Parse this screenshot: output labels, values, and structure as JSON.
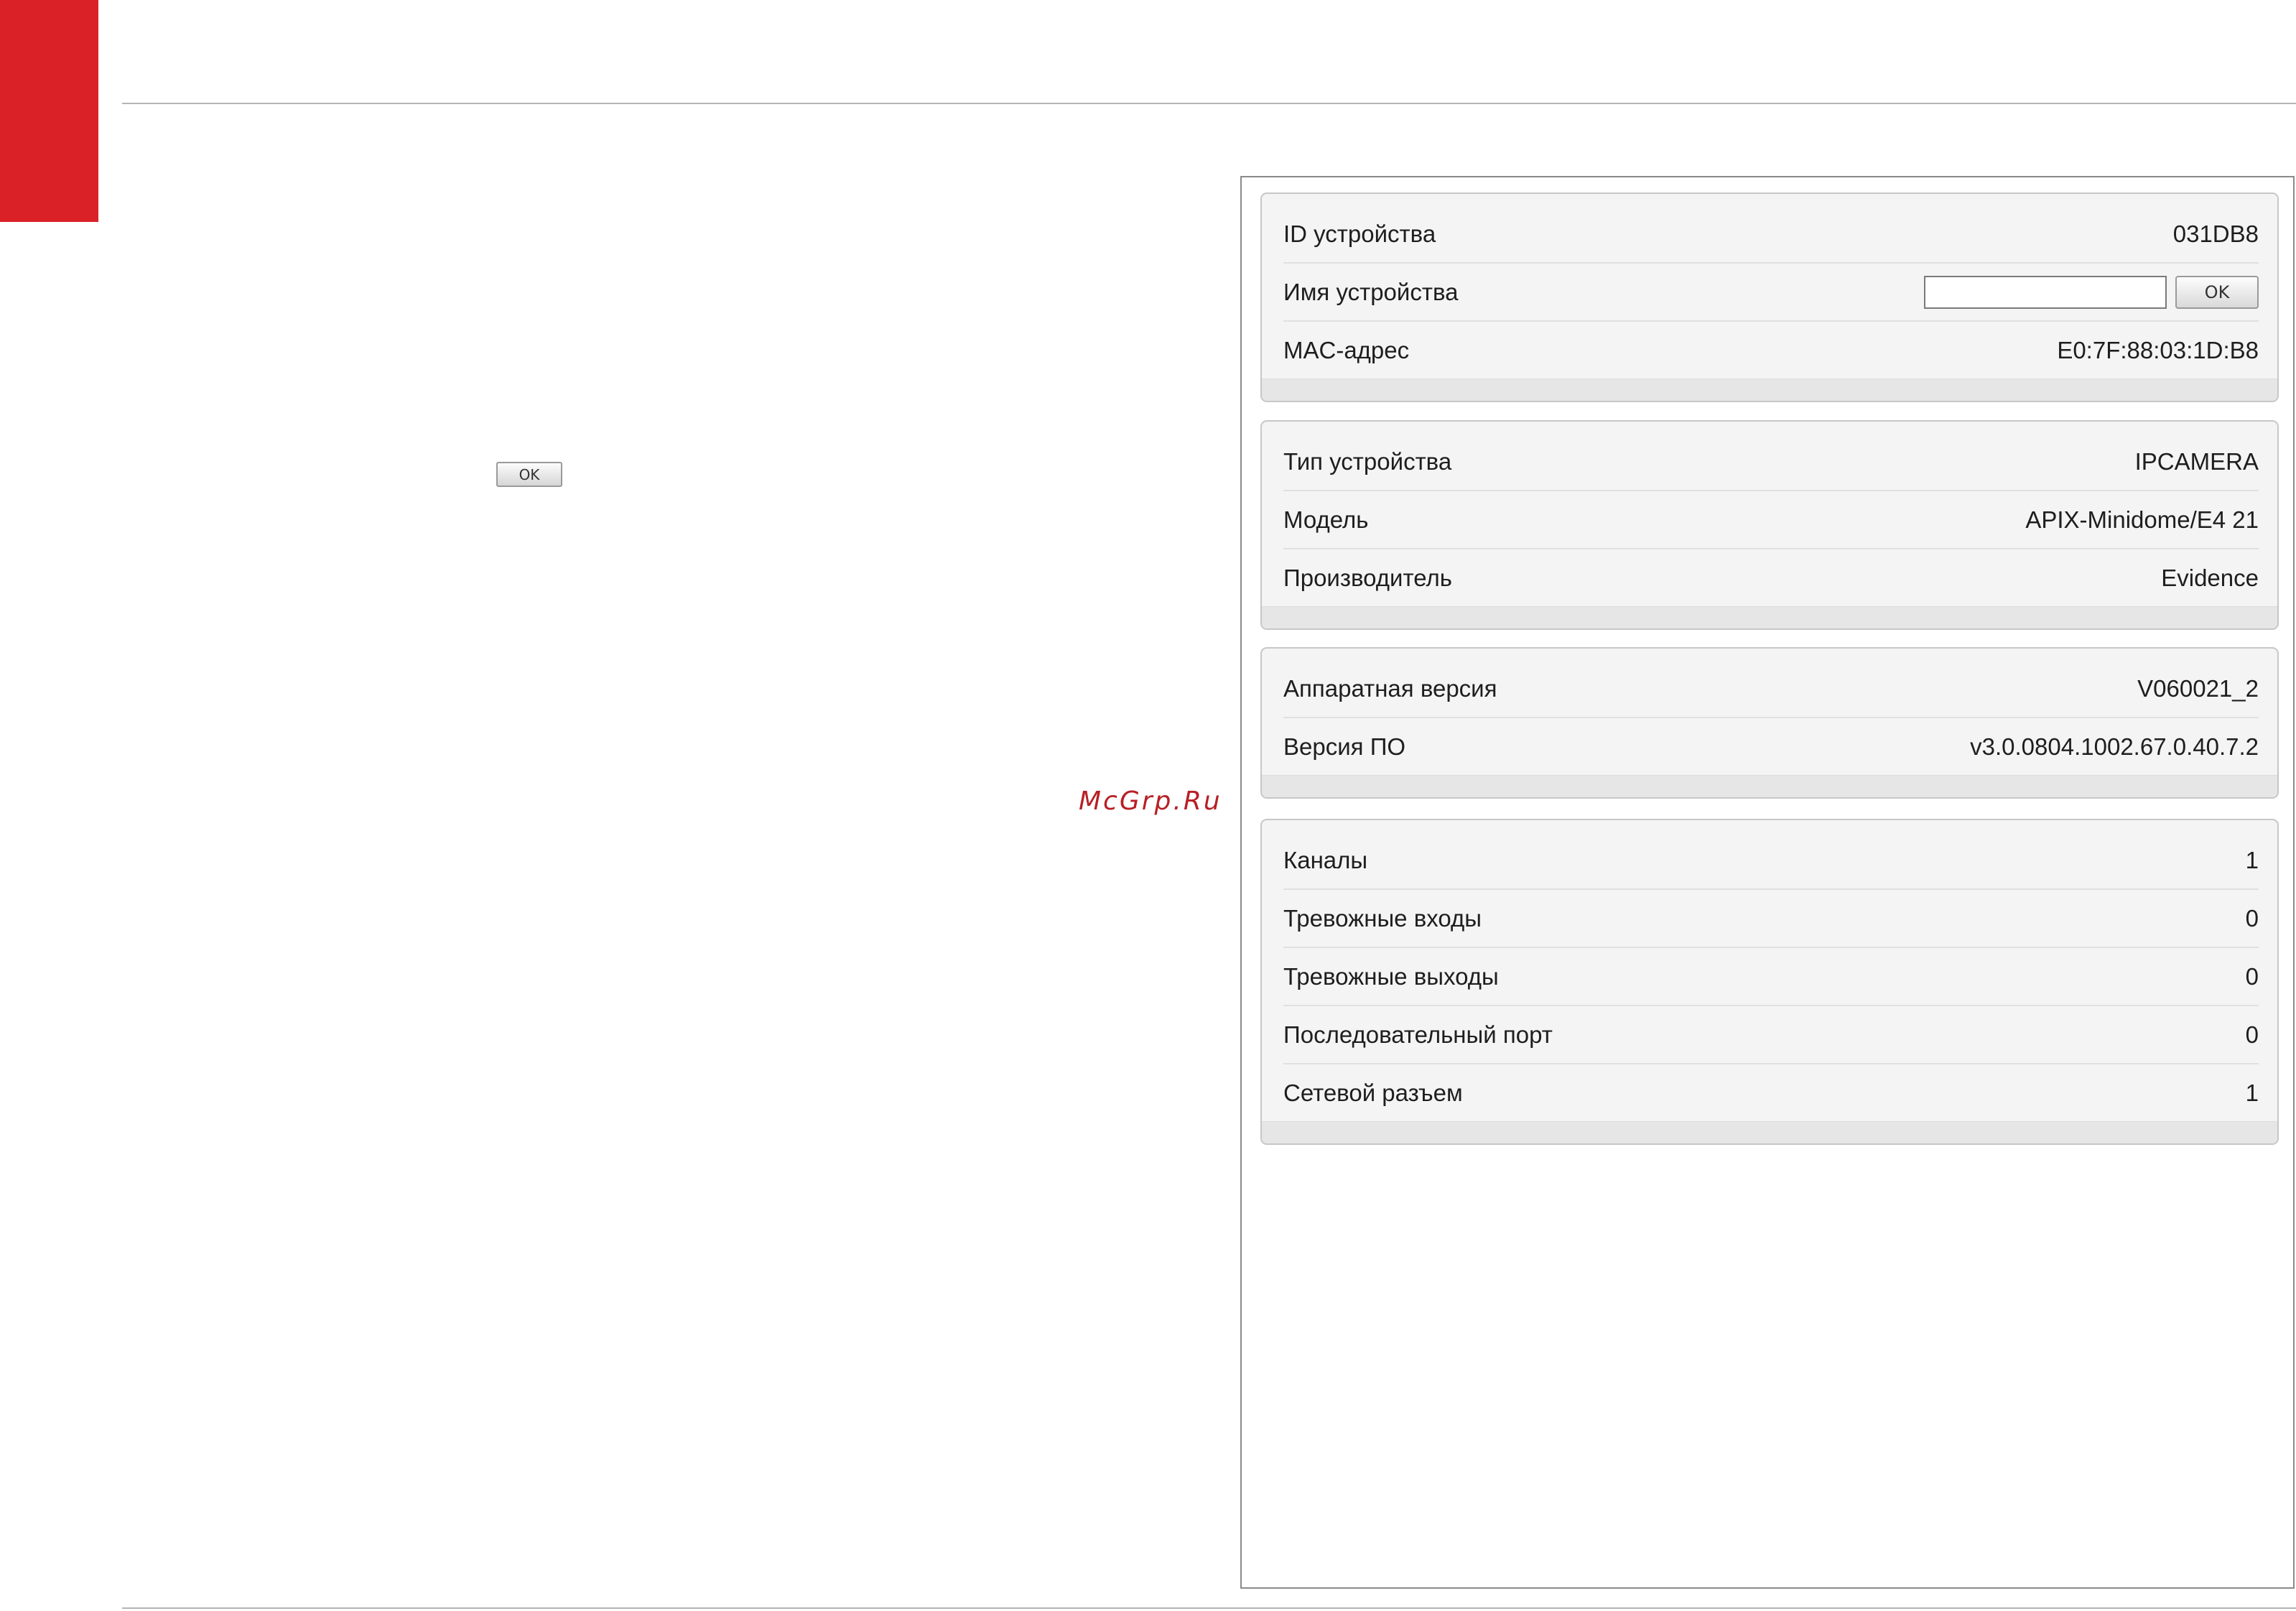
{
  "left": {
    "ok_label": "OK"
  },
  "watermark": "McGrp.Ru",
  "panels": {
    "device_id": {
      "rows": [
        {
          "label": "ID устройства",
          "value": "031DB8"
        },
        {
          "label": "Имя устройства",
          "input_value": "",
          "button_label": "OK"
        },
        {
          "label": "MAC-адрес",
          "value": "E0:7F:88:03:1D:B8"
        }
      ]
    },
    "device_info": {
      "rows": [
        {
          "label": "Тип устройства",
          "value": "IPCAMERA"
        },
        {
          "label": "Модель",
          "value": "APIX-Minidome/E4 21"
        },
        {
          "label": "Производитель",
          "value": "Evidence"
        }
      ]
    },
    "versions": {
      "rows": [
        {
          "label": "Аппаратная версия",
          "value": "V060021_2"
        },
        {
          "label": "Версия ПО",
          "value": "v3.0.0804.1002.67.0.40.7.2"
        }
      ]
    },
    "io": {
      "rows": [
        {
          "label": "Каналы",
          "value": "1"
        },
        {
          "label": "Тревожные входы",
          "value": "0"
        },
        {
          "label": "Тревожные выходы",
          "value": "0"
        },
        {
          "label": "Последовательный порт",
          "value": "0"
        },
        {
          "label": "Сетевой разъем",
          "value": "1"
        }
      ]
    }
  },
  "colors": {
    "accent_red": "#da2128",
    "watermark": "#b72025"
  }
}
